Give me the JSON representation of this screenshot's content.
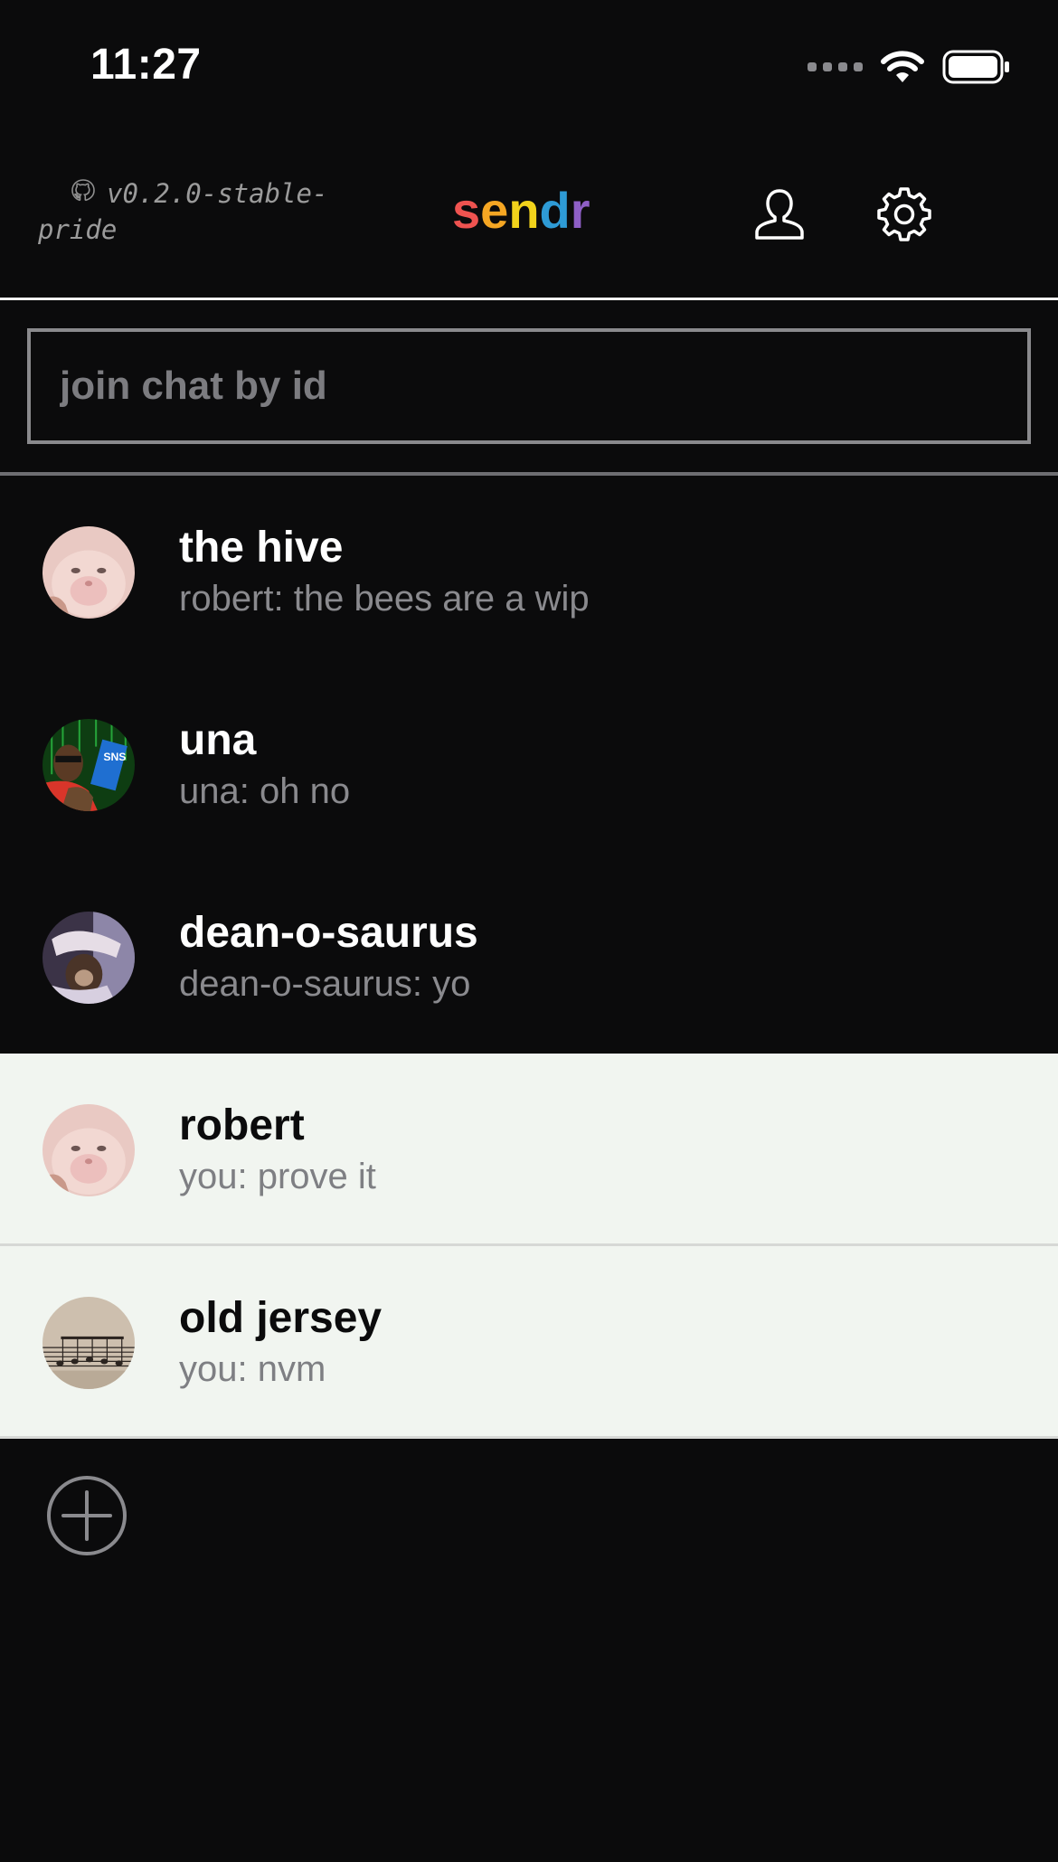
{
  "status_bar": {
    "time": "11:27",
    "icons": [
      "cellular-signal-icon",
      "wifi-icon",
      "battery-icon"
    ]
  },
  "header": {
    "version_text": "v0.2.0-stable-pride",
    "github_icon": "github-icon",
    "logo_letters": [
      {
        "char": "s",
        "color": "#ef5350"
      },
      {
        "char": "e",
        "color": "#f5a623"
      },
      {
        "char": "n",
        "color": "#f2d31b"
      },
      {
        "char": "d",
        "color": "#2e9bd6"
      },
      {
        "char": "r",
        "color": "#8e5fc6"
      }
    ],
    "profile_icon": "person-icon",
    "settings_icon": "gear-icon"
  },
  "search": {
    "placeholder": "join chat by id",
    "value": ""
  },
  "chats": [
    {
      "name": "the hive",
      "preview": "robert: the bees are a wip",
      "theme": "dark",
      "avatar": "cat"
    },
    {
      "name": "una",
      "preview": "una: oh no",
      "theme": "dark",
      "avatar": "matrix"
    },
    {
      "name": "dean-o-saurus",
      "preview": "dean-o-saurus: yo",
      "theme": "dark",
      "avatar": "monkey"
    },
    {
      "name": "robert",
      "preview": "you: prove it",
      "theme": "light",
      "avatar": "cat"
    },
    {
      "name": "old jersey",
      "preview": "you: nvm",
      "theme": "light",
      "avatar": "sheet-music"
    }
  ],
  "add_chat_icon": "plus-circle-icon",
  "colors": {
    "background": "#0b0b0c",
    "light_row": "#f1f5f0",
    "muted_text": "#8a8a8e"
  }
}
